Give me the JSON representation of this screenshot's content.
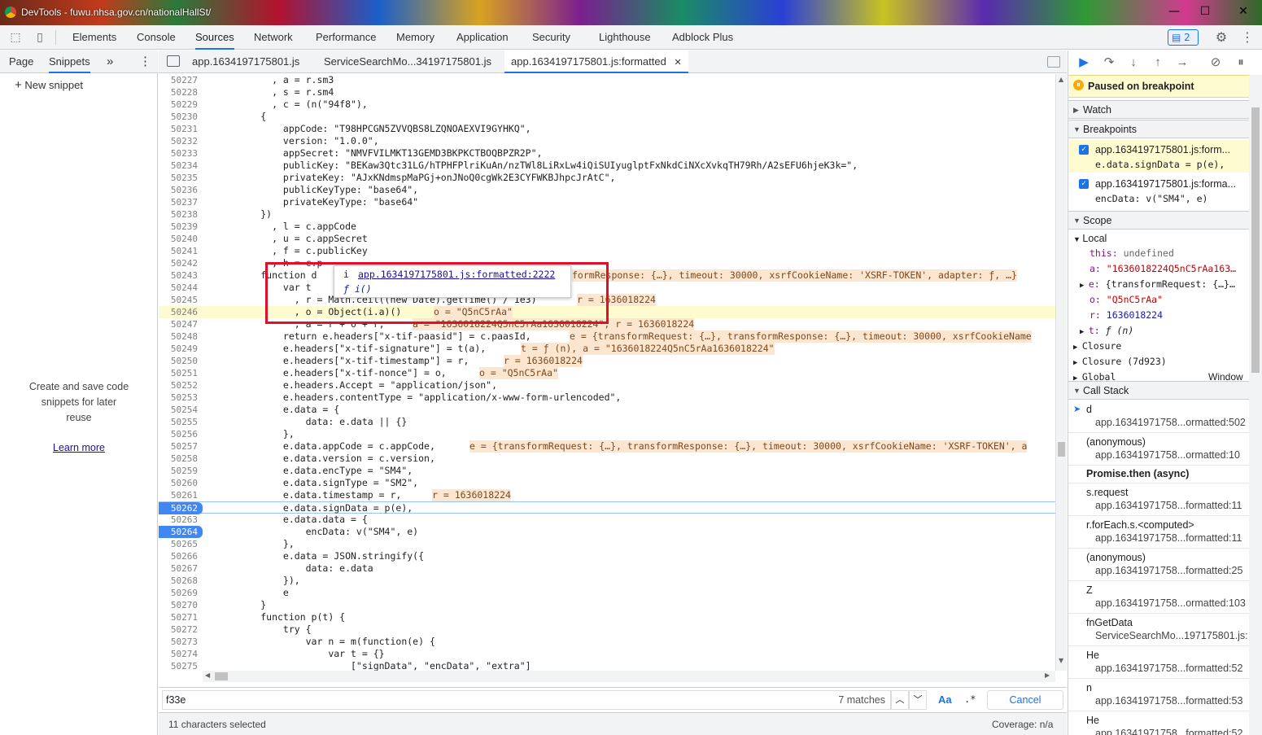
{
  "window": {
    "title": "DevTools - fuwu.nhsa.gov.cn/nationalHallSt/",
    "minimize": "—",
    "maximize": "☐",
    "close": "✕"
  },
  "toolbar": {
    "tabs": [
      "Elements",
      "Console",
      "Sources",
      "Network",
      "Performance",
      "Memory",
      "Application",
      "Security",
      "Lighthouse",
      "Adblock Plus"
    ],
    "messages_badge": "2"
  },
  "navigator": {
    "tabs": [
      "Page",
      "Snippets"
    ],
    "more": "»",
    "new_snippet": "New snippet",
    "empty_text": [
      "Create and save code",
      "snippets for later",
      "reuse"
    ],
    "learn_more": "Learn more"
  },
  "editor_tabs": [
    "app.1634197175801.js",
    "ServiceSearchMo...34197175801.js",
    "app.1634197175801.js:formatted"
  ],
  "code_lines": [
    {
      "n": "50227",
      "t": "            , a = r.sm3"
    },
    {
      "n": "50228",
      "t": "            , s = r.sm4"
    },
    {
      "n": "50229",
      "t": "            , c = (n(\"94f8\"),"
    },
    {
      "n": "50230",
      "t": "          {"
    },
    {
      "n": "50231",
      "t": "              appCode: \"T98HPCGN5ZVVQBS8LZQNOAEXVI9GYHKQ\","
    },
    {
      "n": "50232",
      "t": "              version: \"1.0.0\","
    },
    {
      "n": "50233",
      "t": "              appSecret: \"NMVFVILMKT13GEMD3BKPKCTBOQBPZR2P\","
    },
    {
      "n": "50234",
      "t": "              publicKey: \"BEKaw3Qtc31LG/hTPHFPlriKuAn/nzTWl8LiRxLw4iQiSUIyuglptFxNkdCiNXcXvkqTH79Rh/A2sEFU6hjeK3k=\","
    },
    {
      "n": "50235",
      "t": "              privateKey: \"AJxKNdmspMaPGj+onJNoQ0cgWk2E3CYFWKBJhpcJrAtC\","
    },
    {
      "n": "50236",
      "t": "              publicKeyType: \"base64\","
    },
    {
      "n": "50237",
      "t": "              privateKeyType: \"base64\""
    },
    {
      "n": "50238",
      "t": "          })"
    },
    {
      "n": "50239",
      "t": "            , l = c.appCode"
    },
    {
      "n": "50240",
      "t": "            , u = c.appSecret"
    },
    {
      "n": "50241",
      "t": "            , f = c.publicKey"
    },
    {
      "n": "50242",
      "t": "            , h = c.p"
    },
    {
      "n": "50243",
      "t": "          function d"
    },
    {
      "n": "50244",
      "t": "              var t"
    },
    {
      "n": "50245",
      "t": "                , r = Math.ceil((new Date).getTime() / 1e3)"
    },
    {
      "n": "50246",
      "t": "                , o = Object(i.a)()"
    },
    {
      "n": "50247",
      "t": "                , a = r + o + r;"
    },
    {
      "n": "50248",
      "t": "              return e.headers[\"x-tif-paasid\"] = c.paasId,"
    },
    {
      "n": "50249",
      "t": "              e.headers[\"x-tif-signature\"] = t(a),"
    },
    {
      "n": "50250",
      "t": "              e.headers[\"x-tif-timestamp\"] = r,"
    },
    {
      "n": "50251",
      "t": "              e.headers[\"x-tif-nonce\"] = o,"
    },
    {
      "n": "50252",
      "t": "              e.headers.Accept = \"application/json\","
    },
    {
      "n": "50253",
      "t": "              e.headers.contentType = \"application/x-www-form-urlencoded\","
    },
    {
      "n": "50254",
      "t": "              e.data = {"
    },
    {
      "n": "50255",
      "t": "                  data: e.data || {}"
    },
    {
      "n": "50256",
      "t": "              },"
    },
    {
      "n": "50257",
      "t": "              e.data.appCode = c.appCode,"
    },
    {
      "n": "50258",
      "t": "              e.data.version = c.version,"
    },
    {
      "n": "50259",
      "t": "              e.data.encType = \"SM4\","
    },
    {
      "n": "50260",
      "t": "              e.data.signType = \"SM2\","
    },
    {
      "n": "50261",
      "t": "              e.data.timestamp = r,"
    },
    {
      "n": "50262",
      "t": "              e.data.signData = p(e),"
    },
    {
      "n": "50263",
      "t": "              e.data.data = {"
    },
    {
      "n": "50264",
      "t": "                  encData: v(\"SM4\", e)"
    },
    {
      "n": "50265",
      "t": "              },"
    },
    {
      "n": "50266",
      "t": "              e.data = JSON.stringify({"
    },
    {
      "n": "50267",
      "t": "                  data: e.data"
    },
    {
      "n": "50268",
      "t": "              }),"
    },
    {
      "n": "50269",
      "t": "              e"
    },
    {
      "n": "50270",
      "t": "          }"
    },
    {
      "n": "50271",
      "t": "          function p(t) {"
    },
    {
      "n": "50272",
      "t": "              try {"
    },
    {
      "n": "50273",
      "t": "                  var n = m(function(e) {"
    },
    {
      "n": "50274",
      "t": "                      var t = {}"
    },
    {
      "n": "50275",
      "t": "                          [\"signData\", \"encData\", \"extra\"]"
    }
  ],
  "inline_values": {
    "l50243": "formResponse: {…}, timeout: 30000, xsrfCookieName: 'XSRF-TOKEN', adapter: ƒ, …}",
    "l50245": "r = 1636018224",
    "l50246": "o = \"Q5nC5rAa\"",
    "l50247": "a = \"1636018224Q5nC5rAa1636018224\", r = 1636018224",
    "l50248": "e = {transformRequest: {…}, transformResponse: {…}, timeout: 30000, xsrfCookieName",
    "l50249": "t = ƒ (n), a = \"1636018224Q5nC5rAa1636018224\"",
    "l50250": "r = 1636018224",
    "l50251": "o = \"Q5nC5rAa\"",
    "l50257": "e = {transformRequest: {…}, transformResponse: {…}, timeout: 30000, xsrfCookieName: 'XSRF-TOKEN', a",
    "l50261": "r = 1636018224"
  },
  "popup": {
    "line1_prefix": "i",
    "link": "app.1634197175801.js:formatted:2222",
    "line2": "ƒ i()"
  },
  "search": {
    "value": "f33e",
    "matches": "7 matches",
    "case": "Aa",
    "regex": ".*",
    "cancel": "Cancel"
  },
  "status": {
    "left": "11 characters selected",
    "right": "Coverage: n/a"
  },
  "debugger": {
    "paused": "Paused on breakpoint",
    "watch": "Watch",
    "breakpoints": "Breakpoints",
    "bp_items": [
      {
        "file": "app.1634197175801.js:form...",
        "code": "e.data.signData = p(e),"
      },
      {
        "file": "app.1634197175801.js:forma...",
        "code": "encData: v(\"SM4\", e)"
      }
    ],
    "scope": "Scope",
    "local": "Local",
    "scope_rows": [
      {
        "k": "this:",
        "v": "undefined"
      },
      {
        "k": "a:",
        "v": "\"1636018224Q5nC5rAa163…"
      },
      {
        "k": "e:",
        "v": "{transformRequest: {…}…"
      },
      {
        "k": "o:",
        "v": "\"Q5nC5rAa\""
      },
      {
        "k": "r:",
        "v": "1636018224"
      },
      {
        "k": "t:",
        "v": "ƒ (n)"
      }
    ],
    "closure": "Closure",
    "closure2": "Closure (7d923)",
    "global": "Global",
    "global_val": "Window",
    "callstack": "Call Stack",
    "frames": [
      {
        "fn": "d",
        "loc": "app.16341971758...ormatted:502"
      },
      {
        "fn": "(anonymous)",
        "loc": "app.16341971758...ormatted:10"
      },
      {
        "fn": "Promise.then (async)",
        "loc": ""
      },
      {
        "fn": "s.request",
        "loc": "app.16341971758...formatted:11"
      },
      {
        "fn": "r.forEach.s.<computed>",
        "loc": "app.16341971758...formatted:11"
      },
      {
        "fn": "(anonymous)",
        "loc": "app.16341971758...formatted:25"
      },
      {
        "fn": "Z",
        "loc": "app.16341971758...ormatted:103"
      },
      {
        "fn": "fnGetData",
        "loc": "ServiceSearchMo...197175801.js:"
      },
      {
        "fn": "He",
        "loc": "app.16341971758...formatted:52"
      },
      {
        "fn": "n",
        "loc": "app.16341971758...formatted:53"
      },
      {
        "fn": "He",
        "loc": "app.16341971758...formatted:52"
      }
    ]
  }
}
